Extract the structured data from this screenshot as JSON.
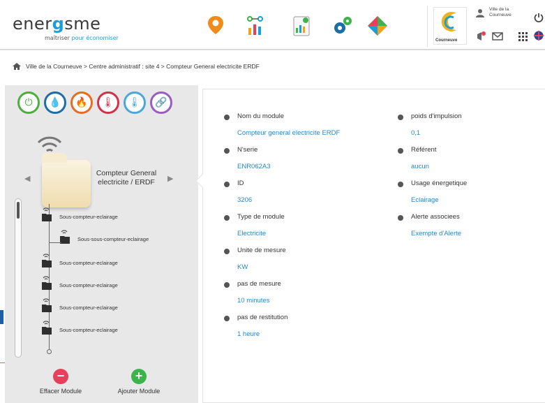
{
  "app": {
    "name_prefix": "ener",
    "name_suffix": "sme",
    "tagline_prefix": "maîtriser",
    "tagline_suffix": "pour économiser"
  },
  "header": {
    "nav_icons": [
      "location-pin-icon",
      "network-icon",
      "report-icon",
      "settings-gears-icon",
      "puzzle-icon"
    ],
    "city_logo_text": "Courneuve",
    "user_name": "Ville de la Courneuve",
    "buttons": [
      "notification-icon",
      "mail-icon",
      "apps-grid-icon",
      "language-flag-icon",
      "power-icon"
    ]
  },
  "breadcrumb": {
    "text": "Ville de la Courneuve > Centre administratif : site 4 > Compteur General electricite ERDF"
  },
  "sidebar": {
    "type_icons": [
      {
        "name": "electricity-icon",
        "glyph": "⏻",
        "color": "#4caf3d"
      },
      {
        "name": "water-icon",
        "glyph": "💧",
        "color": "#1b6ea8"
      },
      {
        "name": "gas-flame-icon",
        "glyph": "🔥",
        "color": "#ec6a1e"
      },
      {
        "name": "temperature-icon",
        "glyph": "🌡",
        "color": "#d62f4a"
      },
      {
        "name": "thermometer-icon",
        "glyph": "🌡",
        "color": "#4aa8d9"
      },
      {
        "name": "link-icon",
        "glyph": "🔗",
        "color": "#9b5cc0"
      }
    ],
    "module_title": "Compteur General electricite / ERDF",
    "tree_items": [
      {
        "label": "Sous-compteur-eclairage"
      },
      {
        "label": "Sous-sous-compteur-eclairage"
      },
      {
        "label": "Sous-compteur-eclairage"
      },
      {
        "label": "Sous-compteur-eclairage"
      },
      {
        "label": "Sous-compteur-eclairage"
      },
      {
        "label": "Sous-compteur-eclairage"
      }
    ],
    "delete_label": "Effacer Module",
    "add_label": "Ajouter Module",
    "delete_color": "#e8405a",
    "add_color": "#3db34a"
  },
  "details": {
    "left_fields": [
      {
        "label": "Nom du module",
        "value": "Compteur general electricite ERDF"
      },
      {
        "label": "N'serie",
        "value": "ENR062A3"
      },
      {
        "label": "ID",
        "value": "3206"
      },
      {
        "label": "Type de module",
        "value": "Electricite"
      },
      {
        "label": "Unite de mesure",
        "value": "KW"
      },
      {
        "label": "pas de mesure",
        "value": "10 minutes"
      },
      {
        "label": "pas de restitution",
        "value": "1 heure"
      }
    ],
    "right_fields": [
      {
        "label": "poids d'impulsion",
        "value": "0,1"
      },
      {
        "label": "Référent",
        "value": "aucun"
      },
      {
        "label": "Usage énergetique",
        "value": "Eclairage"
      },
      {
        "label": "Alerte associees",
        "value": "Exempte d'Alerte"
      }
    ],
    "value_color": "#2a86c4"
  }
}
